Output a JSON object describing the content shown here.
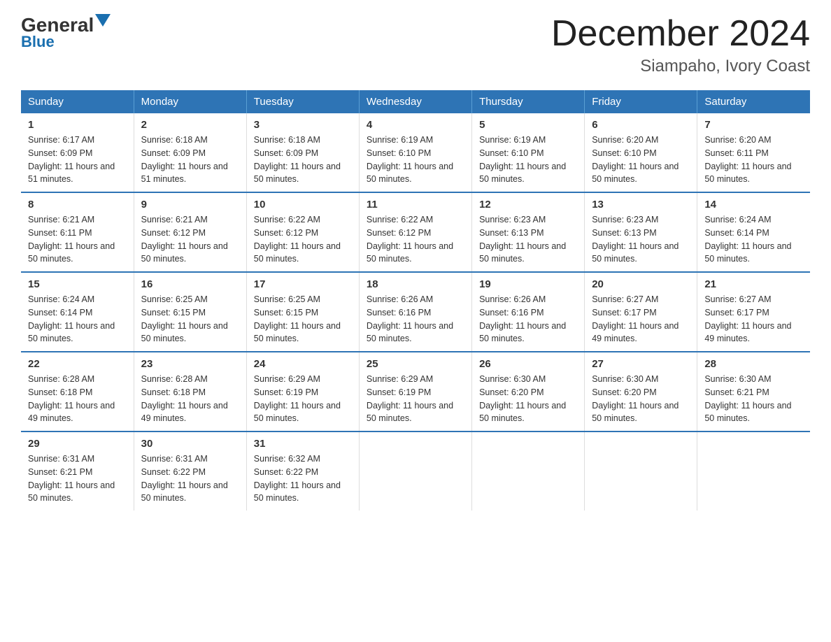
{
  "header": {
    "logo_general": "General",
    "logo_blue": "Blue",
    "title": "December 2024",
    "subtitle": "Siampaho, Ivory Coast"
  },
  "days_of_week": [
    "Sunday",
    "Monday",
    "Tuesday",
    "Wednesday",
    "Thursday",
    "Friday",
    "Saturday"
  ],
  "weeks": [
    [
      {
        "day": "1",
        "sunrise": "6:17 AM",
        "sunset": "6:09 PM",
        "daylight": "11 hours and 51 minutes."
      },
      {
        "day": "2",
        "sunrise": "6:18 AM",
        "sunset": "6:09 PM",
        "daylight": "11 hours and 51 minutes."
      },
      {
        "day": "3",
        "sunrise": "6:18 AM",
        "sunset": "6:09 PM",
        "daylight": "11 hours and 50 minutes."
      },
      {
        "day": "4",
        "sunrise": "6:19 AM",
        "sunset": "6:10 PM",
        "daylight": "11 hours and 50 minutes."
      },
      {
        "day": "5",
        "sunrise": "6:19 AM",
        "sunset": "6:10 PM",
        "daylight": "11 hours and 50 minutes."
      },
      {
        "day": "6",
        "sunrise": "6:20 AM",
        "sunset": "6:10 PM",
        "daylight": "11 hours and 50 minutes."
      },
      {
        "day": "7",
        "sunrise": "6:20 AM",
        "sunset": "6:11 PM",
        "daylight": "11 hours and 50 minutes."
      }
    ],
    [
      {
        "day": "8",
        "sunrise": "6:21 AM",
        "sunset": "6:11 PM",
        "daylight": "11 hours and 50 minutes."
      },
      {
        "day": "9",
        "sunrise": "6:21 AM",
        "sunset": "6:12 PM",
        "daylight": "11 hours and 50 minutes."
      },
      {
        "day": "10",
        "sunrise": "6:22 AM",
        "sunset": "6:12 PM",
        "daylight": "11 hours and 50 minutes."
      },
      {
        "day": "11",
        "sunrise": "6:22 AM",
        "sunset": "6:12 PM",
        "daylight": "11 hours and 50 minutes."
      },
      {
        "day": "12",
        "sunrise": "6:23 AM",
        "sunset": "6:13 PM",
        "daylight": "11 hours and 50 minutes."
      },
      {
        "day": "13",
        "sunrise": "6:23 AM",
        "sunset": "6:13 PM",
        "daylight": "11 hours and 50 minutes."
      },
      {
        "day": "14",
        "sunrise": "6:24 AM",
        "sunset": "6:14 PM",
        "daylight": "11 hours and 50 minutes."
      }
    ],
    [
      {
        "day": "15",
        "sunrise": "6:24 AM",
        "sunset": "6:14 PM",
        "daylight": "11 hours and 50 minutes."
      },
      {
        "day": "16",
        "sunrise": "6:25 AM",
        "sunset": "6:15 PM",
        "daylight": "11 hours and 50 minutes."
      },
      {
        "day": "17",
        "sunrise": "6:25 AM",
        "sunset": "6:15 PM",
        "daylight": "11 hours and 50 minutes."
      },
      {
        "day": "18",
        "sunrise": "6:26 AM",
        "sunset": "6:16 PM",
        "daylight": "11 hours and 50 minutes."
      },
      {
        "day": "19",
        "sunrise": "6:26 AM",
        "sunset": "6:16 PM",
        "daylight": "11 hours and 50 minutes."
      },
      {
        "day": "20",
        "sunrise": "6:27 AM",
        "sunset": "6:17 PM",
        "daylight": "11 hours and 49 minutes."
      },
      {
        "day": "21",
        "sunrise": "6:27 AM",
        "sunset": "6:17 PM",
        "daylight": "11 hours and 49 minutes."
      }
    ],
    [
      {
        "day": "22",
        "sunrise": "6:28 AM",
        "sunset": "6:18 PM",
        "daylight": "11 hours and 49 minutes."
      },
      {
        "day": "23",
        "sunrise": "6:28 AM",
        "sunset": "6:18 PM",
        "daylight": "11 hours and 49 minutes."
      },
      {
        "day": "24",
        "sunrise": "6:29 AM",
        "sunset": "6:19 PM",
        "daylight": "11 hours and 50 minutes."
      },
      {
        "day": "25",
        "sunrise": "6:29 AM",
        "sunset": "6:19 PM",
        "daylight": "11 hours and 50 minutes."
      },
      {
        "day": "26",
        "sunrise": "6:30 AM",
        "sunset": "6:20 PM",
        "daylight": "11 hours and 50 minutes."
      },
      {
        "day": "27",
        "sunrise": "6:30 AM",
        "sunset": "6:20 PM",
        "daylight": "11 hours and 50 minutes."
      },
      {
        "day": "28",
        "sunrise": "6:30 AM",
        "sunset": "6:21 PM",
        "daylight": "11 hours and 50 minutes."
      }
    ],
    [
      {
        "day": "29",
        "sunrise": "6:31 AM",
        "sunset": "6:21 PM",
        "daylight": "11 hours and 50 minutes."
      },
      {
        "day": "30",
        "sunrise": "6:31 AM",
        "sunset": "6:22 PM",
        "daylight": "11 hours and 50 minutes."
      },
      {
        "day": "31",
        "sunrise": "6:32 AM",
        "sunset": "6:22 PM",
        "daylight": "11 hours and 50 minutes."
      },
      null,
      null,
      null,
      null
    ]
  ],
  "labels": {
    "sunrise": "Sunrise:",
    "sunset": "Sunset:",
    "daylight": "Daylight:"
  }
}
